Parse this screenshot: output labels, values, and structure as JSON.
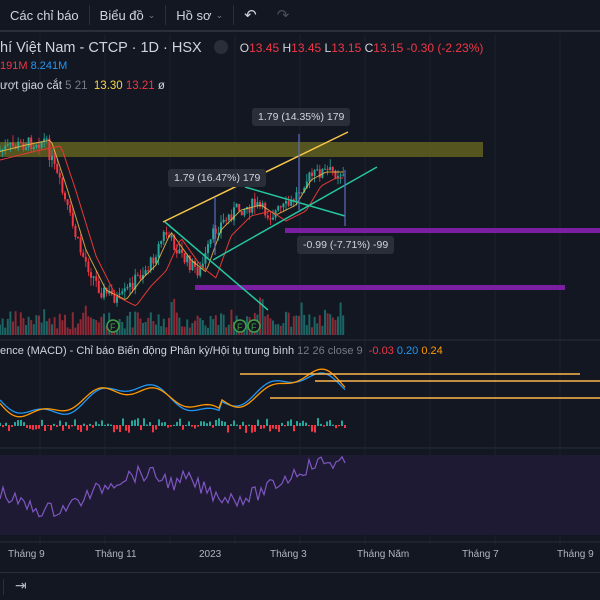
{
  "toolbar": {
    "indicators": "Các chỉ báo",
    "chart": "Biểu đồ",
    "profile": "Hồ sơ",
    "undo_icon": "undo-icon",
    "redo_icon": "redo-icon"
  },
  "legend": {
    "symbol": "hí Việt Nam - CTCP · 1D · HSX",
    "o_label": "O",
    "o": "13.45",
    "h_label": "H",
    "h": "13.45",
    "l_label": "L",
    "l": "13.15",
    "c_label": "C",
    "c": "13.15",
    "change": "-0.30 (-2.23%)",
    "vol1": "191M",
    "vol2": "8.241M",
    "ma_name": "ượt giao cắt",
    "ma_params": "5 21",
    "ma1": "13.30",
    "ma2": "13.21",
    "ma3": "ø"
  },
  "drawings": {
    "label_top": "1.79 (14.35%) 179",
    "label_mid": "1.79 (16.47%) 179",
    "label_low": "-0.99 (-7.71%) -99"
  },
  "macd": {
    "title": "ence (MACD) - Chỉ báo Biến động Phân kỳ/Hội tụ trung bình",
    "params": "12 26 close 9",
    "v1": "-0.03",
    "v2": "0.20",
    "v3": "0.24"
  },
  "time_axis": [
    "Tháng 9",
    "Tháng 11",
    "2023",
    "Tháng 3",
    "Tháng Năm",
    "Tháng 7",
    "Tháng 9"
  ],
  "colors": {
    "up": "#26a69a",
    "down": "#f23645",
    "zone": "#6b6b1f",
    "purple": "#7b1fa2",
    "trend_yellow": "#f7c548",
    "trend_teal": "#26c6a0"
  }
}
